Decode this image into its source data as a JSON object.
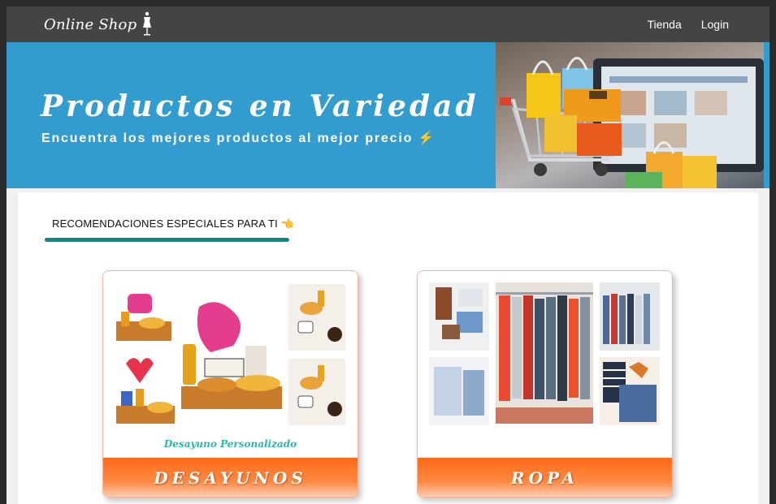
{
  "navbar": {
    "brand": "Online Shop",
    "brand_icon": "mannequin-icon",
    "links": [
      "Tienda",
      "Login"
    ]
  },
  "hero": {
    "title": "Productos en Variedad",
    "subtitle": "Encuentra los mejores productos al mejor precio ⚡",
    "image_icon": "shopping-cart-icon"
  },
  "section": {
    "title": "RECOMENDACIONES ESPECIALES PARA TI 👈"
  },
  "cards": [
    {
      "label": "DESAYUNOS",
      "caption": "Desayuno Personalizado"
    },
    {
      "label": "ROPA"
    }
  ],
  "colors": {
    "navbar": "#444444",
    "hero": "#339ccf",
    "accent_underline": "#0e8a84",
    "card_footer": "#ff6a16",
    "caption": "#29b6b0"
  }
}
